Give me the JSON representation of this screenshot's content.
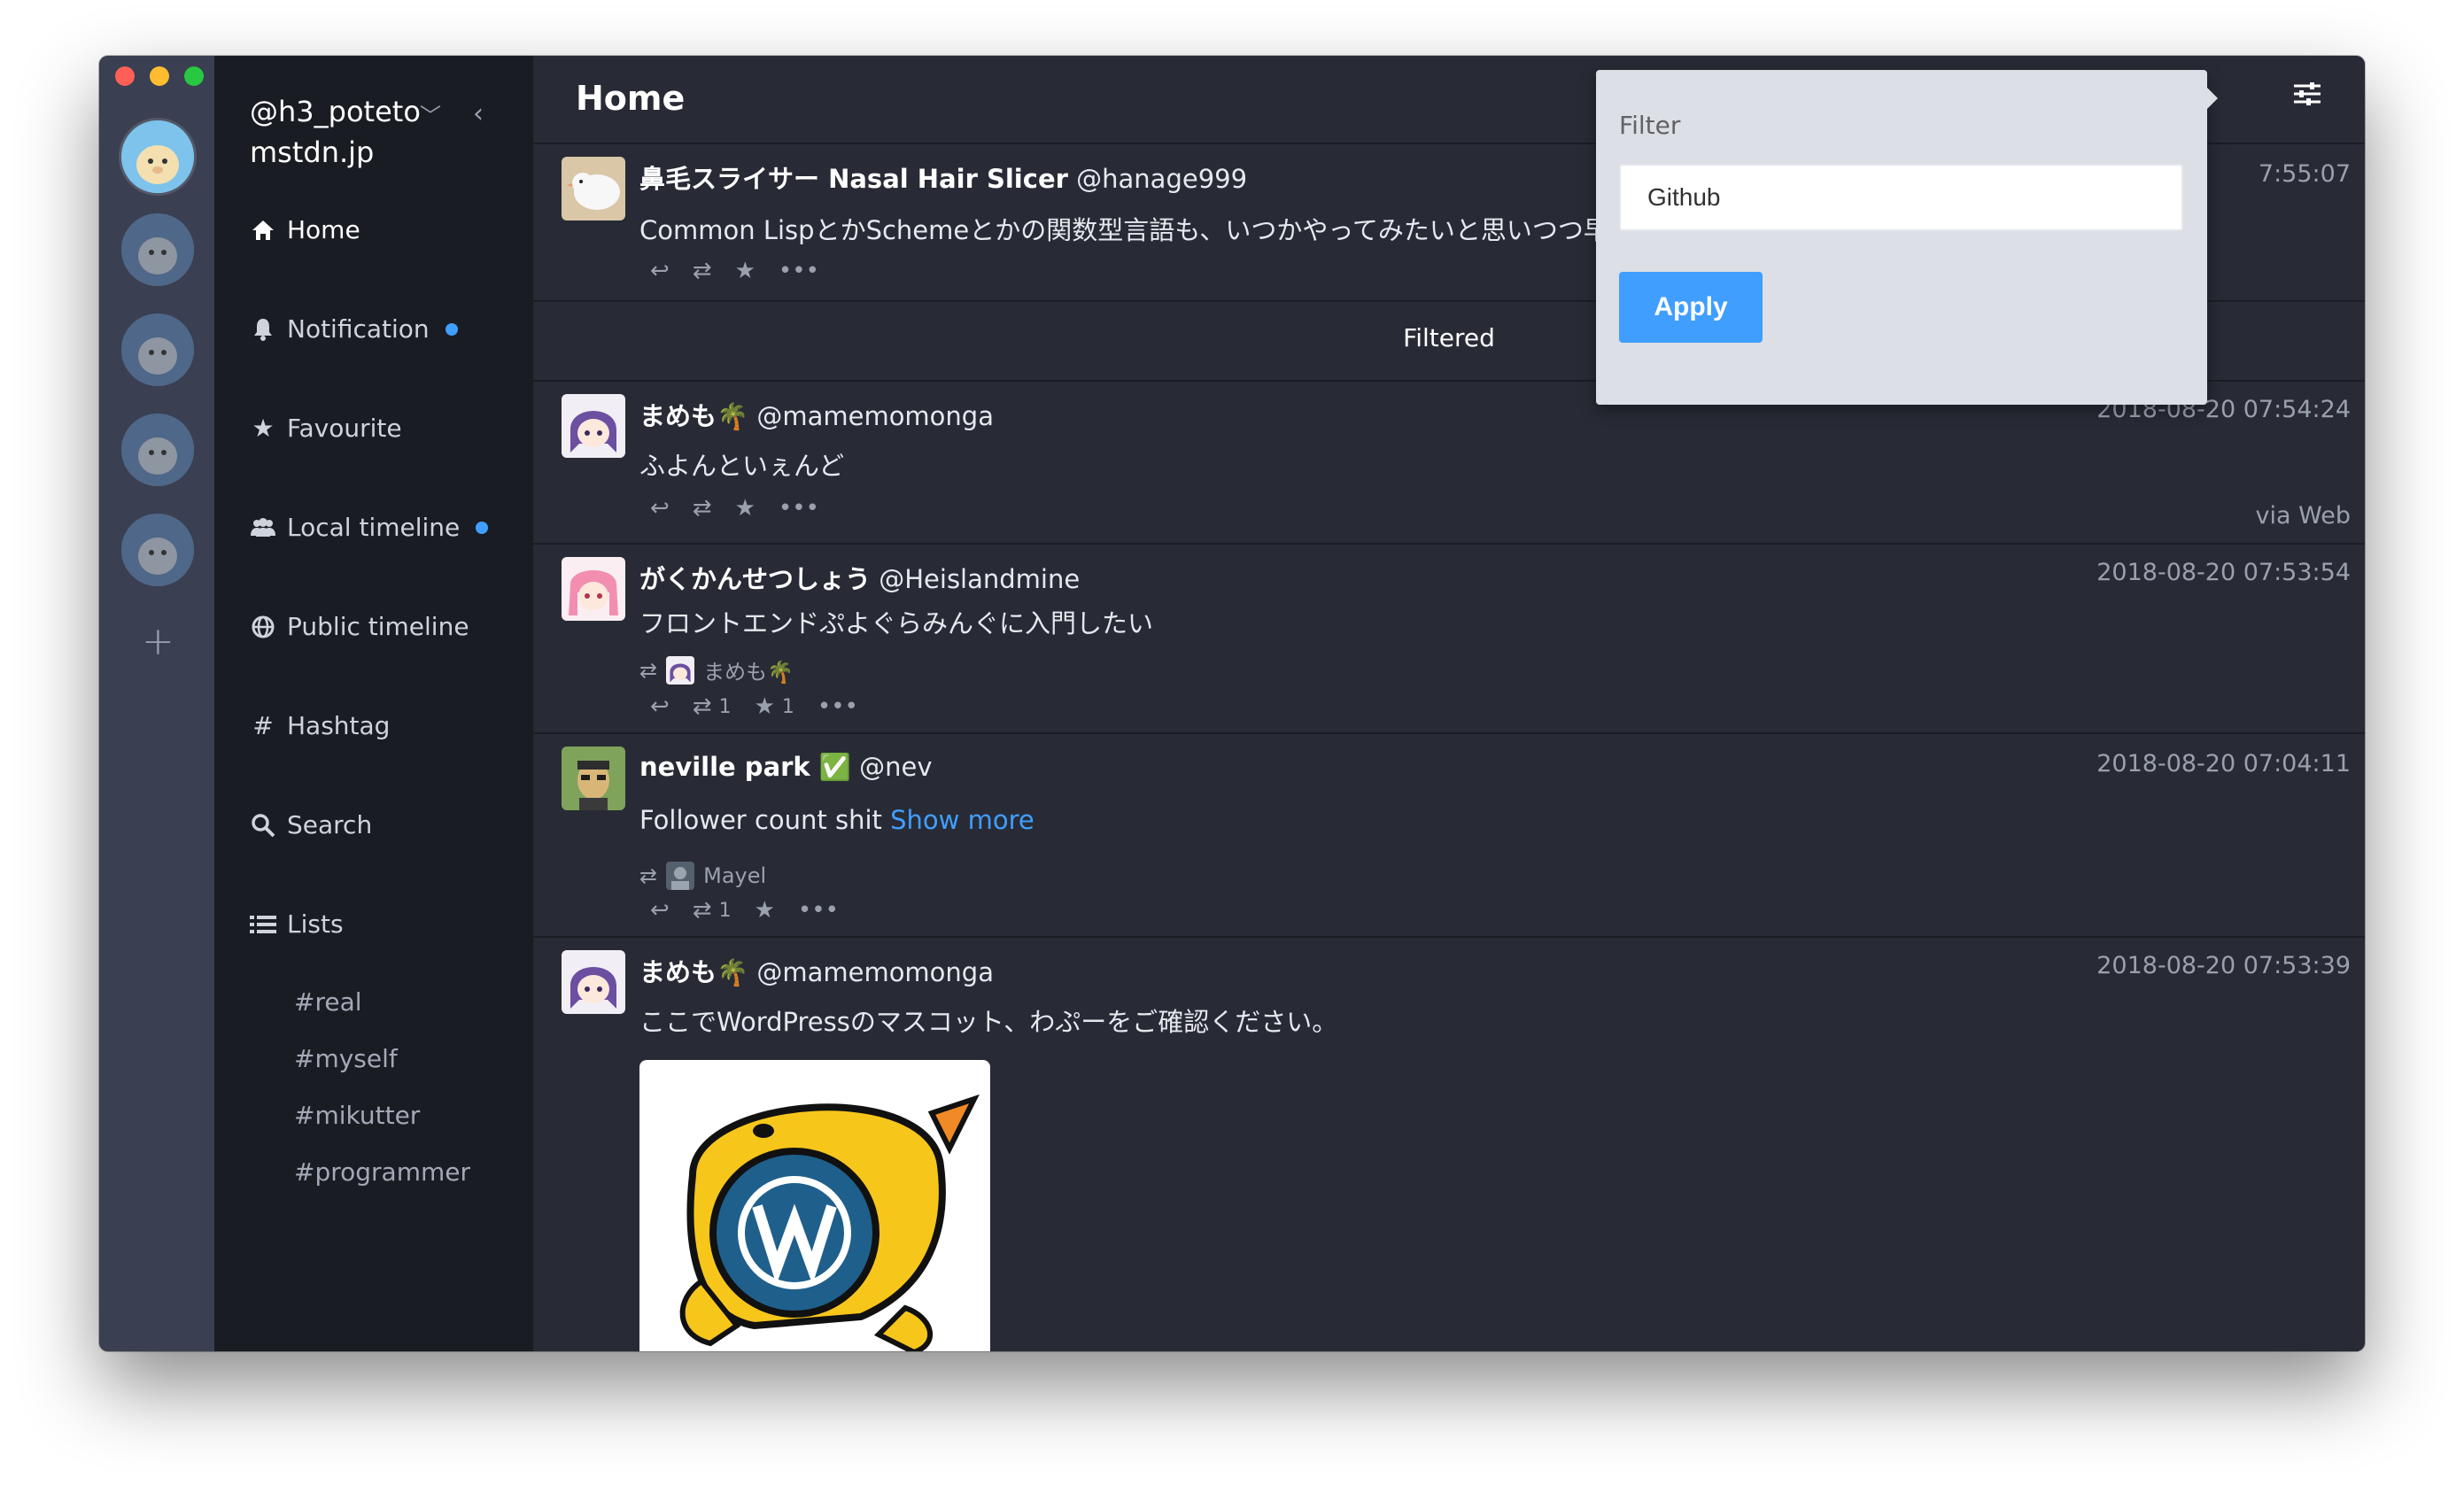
{
  "colors": {
    "accent": "#409eff",
    "rail": "#3a3f51",
    "sidebar": "#1a1c24",
    "timeline": "#282b35"
  },
  "account": {
    "username": "@h3_poteto",
    "instance": "mstdn.jp"
  },
  "menu": {
    "home": "Home",
    "notification": "Notification",
    "favourite": "Favourite",
    "local": "Local timeline",
    "public": "Public timeline",
    "hashtag": "Hashtag",
    "search": "Search",
    "lists": "Lists"
  },
  "lists": [
    "#real",
    "#myself",
    "#mikutter",
    "#programmer"
  ],
  "timeline": {
    "title": "Home",
    "filtered_label": "Filtered"
  },
  "filter": {
    "label": "Filter",
    "value": "Github",
    "apply": "Apply"
  },
  "toots": [
    {
      "display_name": "鼻毛スライサー Nasal Hair Slicer",
      "acct": "@hanage999",
      "time": "7:55:07",
      "content": "Common LispとかSchemeとかの関数型言語も、いつかやってみたいと思いつつ早幾年"
    },
    {
      "display_name": "まめも🌴",
      "acct": "@mamemomonga",
      "time": "2018-08-20 07:54:24",
      "content": "ふよんといぇんど",
      "via": "via Web"
    },
    {
      "display_name": "がくかんせつしょう",
      "acct": "@Heislandmine",
      "time": "2018-08-20 07:53:54",
      "content": "フロントエンドぷよぐらみんぐに入門したい",
      "reblogged_by": "まめも🌴",
      "reblogs": "1",
      "favs": "1"
    },
    {
      "display_name": "neville park ✅",
      "acct": "@nev",
      "time": "2018-08-20 07:04:11",
      "content": "Follower count shit",
      "show_more": "Show more",
      "reblogged_by": "Mayel",
      "reblogs": "1"
    },
    {
      "display_name": "まめも🌴",
      "acct": "@mamemomonga",
      "time": "2018-08-20 07:53:39",
      "content": "ここでWordPressのマスコット、わぷーをご確認ください。"
    }
  ]
}
